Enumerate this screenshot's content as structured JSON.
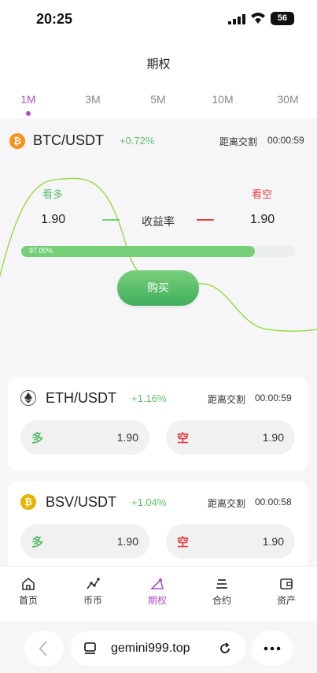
{
  "status_bar": {
    "time": "20:25",
    "battery": "56"
  },
  "header": {
    "title": "期权"
  },
  "period_tabs": [
    {
      "label": "1M",
      "active": true
    },
    {
      "label": "3M",
      "active": false
    },
    {
      "label": "5M",
      "active": false
    },
    {
      "label": "10M",
      "active": false
    },
    {
      "label": "30M",
      "active": false
    }
  ],
  "main_card": {
    "coin_icon": "bitcoin-icon",
    "pair": "BTC/USDT",
    "change": "+0.72%",
    "countdown_label": "距离交割",
    "countdown": "00:00:59",
    "bull_label": "看多",
    "bear_label": "看空",
    "bull_odds": "1.90",
    "bear_odds": "1.90",
    "yield_label": "收益率",
    "progress_text": "97.00%",
    "progress_value": 0.97,
    "buy_label": "购买"
  },
  "markets": [
    {
      "coin_icon": "ethereum-icon",
      "pair": "ETH/USDT",
      "change": "+1.16%",
      "countdown_label": "距离交割",
      "countdown": "00:00:59",
      "long_label": "多",
      "long_odds": "1.90",
      "short_label": "空",
      "short_odds": "1.90"
    },
    {
      "coin_icon": "bitcoin-sv-icon",
      "pair": "BSV/USDT",
      "change": "+1.04%",
      "countdown_label": "距离交割",
      "countdown": "00:00:58",
      "long_label": "多",
      "long_odds": "1.90",
      "short_label": "空",
      "short_odds": "1.90"
    }
  ],
  "bottom_nav": [
    {
      "label": "首页",
      "icon": "home-icon",
      "active": false
    },
    {
      "label": "币币",
      "icon": "trend-icon",
      "active": false
    },
    {
      "label": "期权",
      "icon": "options-icon",
      "active": true
    },
    {
      "label": "合约",
      "icon": "contract-icon",
      "active": false
    },
    {
      "label": "资产",
      "icon": "wallet-icon",
      "active": false
    }
  ],
  "browser": {
    "url": "gemini999.top"
  },
  "colors": {
    "accent": "#b04ec8",
    "up": "#5cbf6a",
    "down": "#e8413e",
    "bitcoin": "#f7931a",
    "bsv": "#eab300"
  }
}
